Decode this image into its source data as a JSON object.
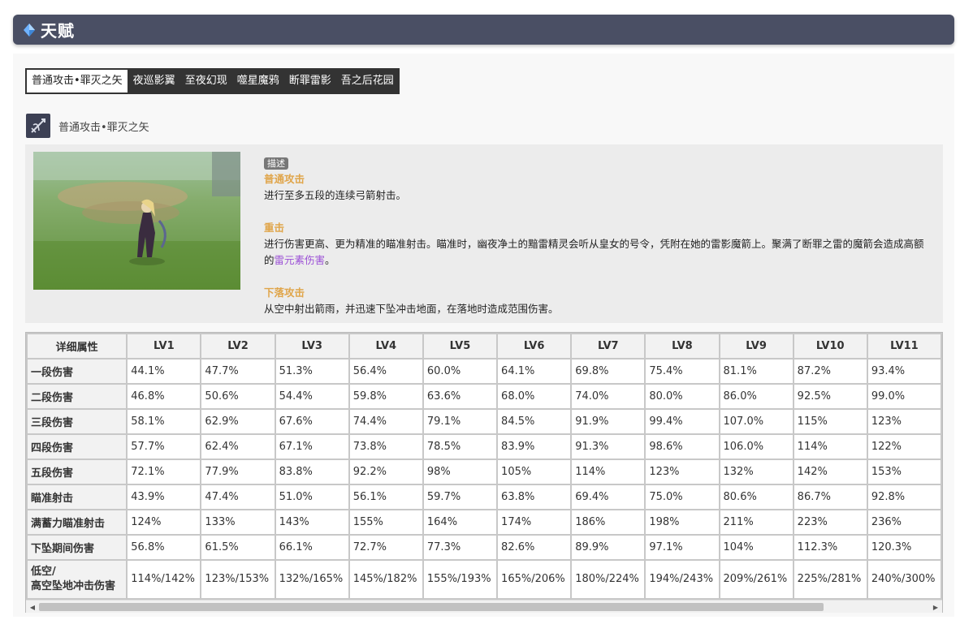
{
  "header": {
    "title": "天赋"
  },
  "tabs": [
    {
      "label": "普通攻击•罪灭之矢",
      "active": true
    },
    {
      "label": "夜巡影翼"
    },
    {
      "label": "至夜幻现"
    },
    {
      "label": "噬星魔鸦"
    },
    {
      "label": "断罪雷影"
    },
    {
      "label": "吾之后花园"
    }
  ],
  "skill": {
    "name": "普通攻击•罪灭之矢",
    "icon": "bow-arrows-icon"
  },
  "description": {
    "badge": "描述",
    "normal_title": "普通攻击",
    "normal_text": "进行至多五段的连续弓箭射击。",
    "charged_title": "重击",
    "charged_text_1": "进行伤害更高、更为精准的瞄准射击。瞄准时，幽夜净土的黯雷精灵会听从皇女的号令，凭附在她的雷影魔箭上。聚满了断罪之雷的魔箭会造成高额的",
    "charged_element": "雷元素伤害",
    "charged_text_2": "。",
    "plunge_title": "下落攻击",
    "plunge_text": "从空中射出箭雨，并迅速下坠冲击地面，在落地时造成范围伤害。"
  },
  "table": {
    "header": [
      "详细属性",
      "LV1",
      "LV2",
      "LV3",
      "LV4",
      "LV5",
      "LV6",
      "LV7",
      "LV8",
      "LV9",
      "LV10",
      "LV11"
    ],
    "rows": [
      {
        "label": "一段伤害",
        "values": [
          "44.1%",
          "47.7%",
          "51.3%",
          "56.4%",
          "60.0%",
          "64.1%",
          "69.8%",
          "75.4%",
          "81.1%",
          "87.2%",
          "93.4%"
        ]
      },
      {
        "label": "二段伤害",
        "values": [
          "46.8%",
          "50.6%",
          "54.4%",
          "59.8%",
          "63.6%",
          "68.0%",
          "74.0%",
          "80.0%",
          "86.0%",
          "92.5%",
          "99.0%"
        ]
      },
      {
        "label": "三段伤害",
        "values": [
          "58.1%",
          "62.9%",
          "67.6%",
          "74.4%",
          "79.1%",
          "84.5%",
          "91.9%",
          "99.4%",
          "107.0%",
          "115%",
          "123%"
        ]
      },
      {
        "label": "四段伤害",
        "values": [
          "57.7%",
          "62.4%",
          "67.1%",
          "73.8%",
          "78.5%",
          "83.9%",
          "91.3%",
          "98.6%",
          "106.0%",
          "114%",
          "122%"
        ]
      },
      {
        "label": "五段伤害",
        "values": [
          "72.1%",
          "77.9%",
          "83.8%",
          "92.2%",
          "98%",
          "105%",
          "114%",
          "123%",
          "132%",
          "142%",
          "153%"
        ]
      },
      {
        "label": "瞄准射击",
        "values": [
          "43.9%",
          "47.4%",
          "51.0%",
          "56.1%",
          "59.7%",
          "63.8%",
          "69.4%",
          "75.0%",
          "80.6%",
          "86.7%",
          "92.8%"
        ]
      },
      {
        "label": "满蓄力瞄准射击",
        "values": [
          "124%",
          "133%",
          "143%",
          "155%",
          "164%",
          "174%",
          "186%",
          "198%",
          "211%",
          "223%",
          "236%"
        ]
      },
      {
        "label": "下坠期间伤害",
        "values": [
          "56.8%",
          "61.5%",
          "66.1%",
          "72.7%",
          "77.3%",
          "82.6%",
          "89.9%",
          "97.1%",
          "104%",
          "112.3%",
          "120.3%"
        ]
      }
    ],
    "last_row": {
      "label_line1": "低空/",
      "label_line2": "高空坠地冲击伤害",
      "values": [
        "114%/142%",
        "123%/153%",
        "132%/165%",
        "145%/182%",
        "155%/193%",
        "165%/206%",
        "180%/224%",
        "194%/243%",
        "209%/261%",
        "225%/281%",
        "240%/300%"
      ]
    }
  }
}
